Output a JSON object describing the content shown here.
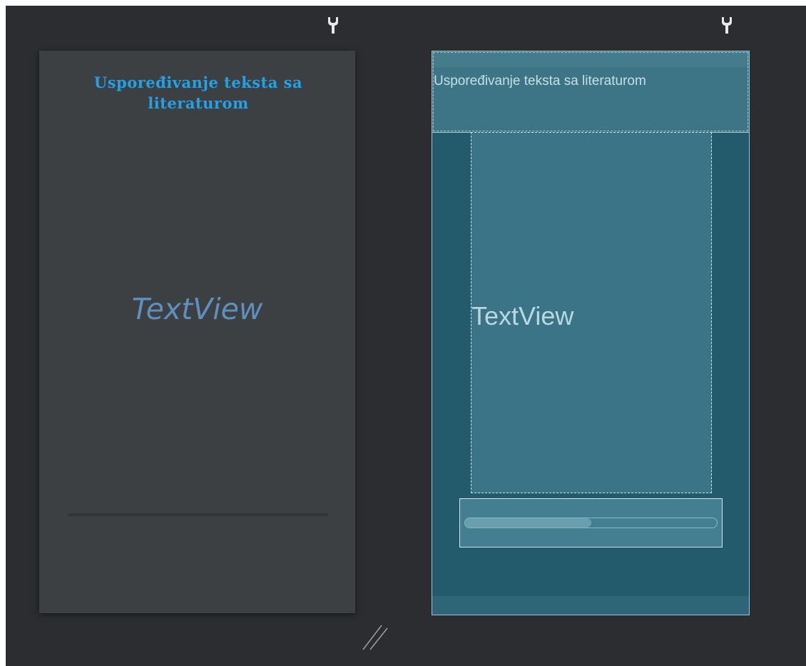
{
  "design_view": {
    "title": "Uspoređivanje teksta  sa literaturom",
    "textview_label": "TextView",
    "progress": 0.0
  },
  "blueprint_view": {
    "title": "Uspoređivanje teksta  sa literaturom",
    "textview_label": "TextView",
    "progress": 0.5
  },
  "icons": {
    "design_tools": "wrench-icon",
    "blueprint_tools": "wrench-icon",
    "resize": "resize-handle-icon"
  },
  "colors": {
    "canvas_bg": "#2b2d30",
    "design_bg": "#3c4043",
    "design_title": "#22a1e6",
    "design_textview": "#5e8fbd",
    "blueprint_bg": "#235b6c",
    "blueprint_header": "#3e7586"
  }
}
